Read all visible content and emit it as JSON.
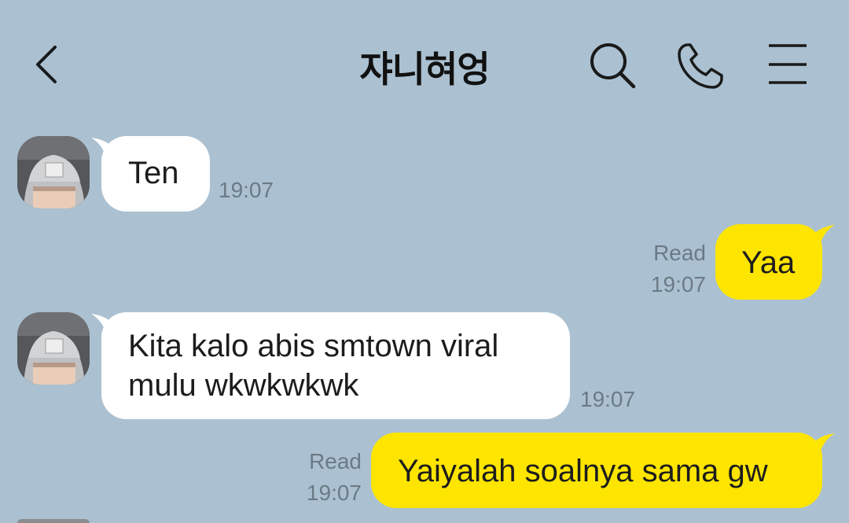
{
  "header": {
    "title": "쟈니혀엉"
  },
  "messages": [
    {
      "direction": "in",
      "text": "Ten",
      "time": "19:07"
    },
    {
      "direction": "out",
      "text": "Yaa",
      "read": "Read",
      "time": "19:07"
    },
    {
      "direction": "in",
      "text_line1": "Kita kalo abis smtown viral",
      "text_line2": "mulu wkwkwkwk",
      "time": "19:07"
    },
    {
      "direction": "out",
      "text": "Yaiyalah soalnya sama gw",
      "read": "Read",
      "time": "19:07"
    }
  ],
  "colors": {
    "background": "#abc1d1",
    "incoming_bubble": "#ffffff",
    "outgoing_bubble": "#fee500",
    "meta_text": "#6b7a86"
  },
  "icons": {
    "back": "chevron-left-icon",
    "search": "search-icon",
    "call": "phone-icon",
    "menu": "hamburger-menu-icon"
  }
}
